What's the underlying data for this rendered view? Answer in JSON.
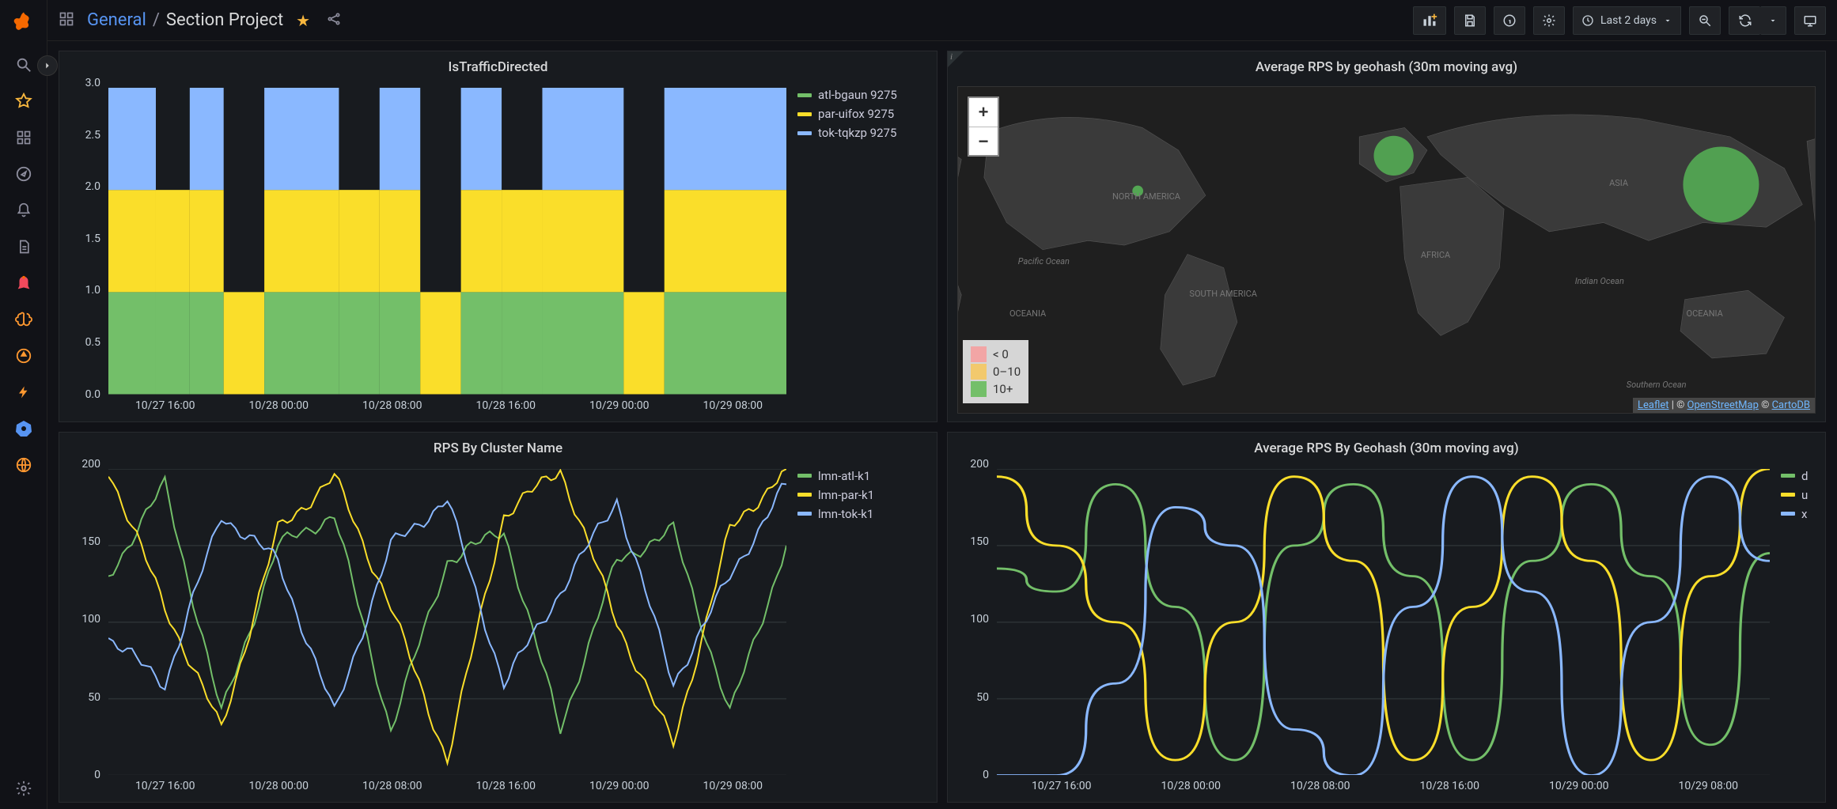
{
  "breadcrumb": {
    "root": "General",
    "sep": "/",
    "current": "Section Project"
  },
  "timepicker": {
    "label": "Last 2 days"
  },
  "sidebar": {},
  "panels": {
    "traffic": {
      "title": "IsTrafficDirected",
      "legend": [
        {
          "label": "atl-bgaun 9275",
          "color": "#73BF69"
        },
        {
          "label": "par-uifox 9275",
          "color": "#FADE2A"
        },
        {
          "label": "tok-tqkzp 9275",
          "color": "#8AB8FF"
        }
      ],
      "yTicks": [
        "0.0",
        "0.5",
        "1.0",
        "1.5",
        "2.0",
        "2.5",
        "3.0"
      ],
      "xTicks": [
        "10/27 16:00",
        "10/28 00:00",
        "10/28 08:00",
        "10/28 16:00",
        "10/29 00:00",
        "10/29 08:00"
      ]
    },
    "map": {
      "title": "Average RPS by geohash (30m moving avg)",
      "legend": [
        {
          "label": "< 0",
          "color": "#f2a5a5"
        },
        {
          "label": "0–10",
          "color": "#f2c96d"
        },
        {
          "label": "10+",
          "color": "#73BF69"
        }
      ],
      "attr": {
        "leaflet": "Leaflet",
        "sep1": " | © ",
        "osm": "OpenStreetMap",
        "sep2": " © ",
        "carto": "CartoDB"
      },
      "labels": {
        "na": "NORTH\nAMERICA",
        "sa": "SOUTH\nAMERICA",
        "af": "AFRICA",
        "asia": "ASIA",
        "oc1": "OCEANIA",
        "oc2": "OCEANIA",
        "po": "Pacific\nOcean",
        "io": "Indian\nOcean",
        "so": "Southern\nOcean"
      }
    },
    "rps_cluster": {
      "title": "RPS By Cluster Name",
      "legend": [
        {
          "label": "lmn-atl-k1",
          "color": "#73BF69"
        },
        {
          "label": "lmn-par-k1",
          "color": "#FADE2A"
        },
        {
          "label": "lmn-tok-k1",
          "color": "#8AB8FF"
        }
      ],
      "yTicks": [
        "0",
        "50",
        "100",
        "150",
        "200"
      ],
      "xTicks": [
        "10/27 16:00",
        "10/28 00:00",
        "10/28 08:00",
        "10/28 16:00",
        "10/29 00:00",
        "10/29 08:00"
      ]
    },
    "rps_geohash": {
      "title": "Average RPS By Geohash (30m moving avg)",
      "legend": [
        {
          "label": "d",
          "color": "#73BF69"
        },
        {
          "label": "u",
          "color": "#FADE2A"
        },
        {
          "label": "x",
          "color": "#8AB8FF"
        }
      ],
      "yTicks": [
        "0",
        "50",
        "100",
        "150",
        "200"
      ],
      "xTicks": [
        "10/27 16:00",
        "10/28 00:00",
        "10/28 08:00",
        "10/28 16:00",
        "10/29 00:00",
        "10/29 08:00"
      ]
    }
  },
  "chart_data": [
    {
      "id": "traffic",
      "type": "bar",
      "title": "IsTrafficDirected",
      "xlabel": "",
      "ylabel": "",
      "ylim": [
        0,
        3
      ],
      "categories": [
        "10/27 16:00",
        "10/28 00:00",
        "10/28 08:00",
        "10/28 16:00",
        "10/29 00:00",
        "10/29 08:00"
      ],
      "series": [
        {
          "name": "atl-bgaun 9275",
          "values": [
            1,
            0,
            1,
            1,
            0,
            1
          ]
        },
        {
          "name": "par-uifox 9275",
          "values": [
            1,
            1,
            1,
            1,
            1,
            1
          ]
        },
        {
          "name": "tok-tqkzp 9275",
          "values": [
            1,
            0,
            1,
            0,
            1,
            1
          ]
        }
      ]
    },
    {
      "id": "rps_cluster",
      "type": "line",
      "title": "RPS By Cluster Name",
      "ylim": [
        0,
        200
      ],
      "x": [
        "10/27 16:00",
        "10/28 00:00",
        "10/28 08:00",
        "10/28 16:00",
        "10/29 00:00",
        "10/29 08:00"
      ],
      "series": [
        {
          "name": "lmn-atl-k1",
          "values": [
            130,
            190,
            40,
            150,
            170,
            30,
            140,
            160,
            30,
            140,
            160,
            40,
            150
          ]
        },
        {
          "name": "lmn-par-k1",
          "values": [
            200,
            110,
            30,
            160,
            195,
            110,
            10,
            170,
            200,
            100,
            20,
            160,
            200
          ]
        },
        {
          "name": "lmn-tok-k1",
          "values": [
            90,
            60,
            170,
            140,
            40,
            150,
            180,
            60,
            120,
            180,
            60,
            130,
            190
          ]
        }
      ]
    },
    {
      "id": "rps_geohash",
      "type": "line",
      "title": "Average RPS By Geohash (30m moving avg)",
      "ylim": [
        0,
        200
      ],
      "x": [
        "10/27 16:00",
        "10/28 00:00",
        "10/28 08:00",
        "10/28 16:00",
        "10/29 00:00",
        "10/29 08:00"
      ],
      "series": [
        {
          "name": "d",
          "values": [
            135,
            120,
            190,
            110,
            10,
            150,
            190,
            130,
            10,
            140,
            190,
            130,
            20,
            145
          ]
        },
        {
          "name": "u",
          "values": [
            195,
            150,
            100,
            10,
            100,
            195,
            140,
            10,
            110,
            195,
            140,
            10,
            130,
            200
          ]
        },
        {
          "name": "x",
          "values": [
            0,
            0,
            60,
            175,
            150,
            30,
            0,
            110,
            195,
            120,
            0,
            100,
            195,
            140
          ]
        }
      ]
    },
    {
      "id": "map",
      "type": "map",
      "title": "Average RPS by geohash (30m moving avg)",
      "points": [
        {
          "geohash": "d",
          "lat": 34,
          "lon": -84,
          "value": 12,
          "radius_px": 10
        },
        {
          "geohash": "u",
          "lat": 49,
          "lon": 2,
          "value": 30,
          "radius_px": 28
        },
        {
          "geohash": "x",
          "lat": 36,
          "lon": 140,
          "value": 85,
          "radius_px": 52
        }
      ],
      "legend_bins": [
        "< 0",
        "0–10",
        "10+"
      ]
    }
  ]
}
